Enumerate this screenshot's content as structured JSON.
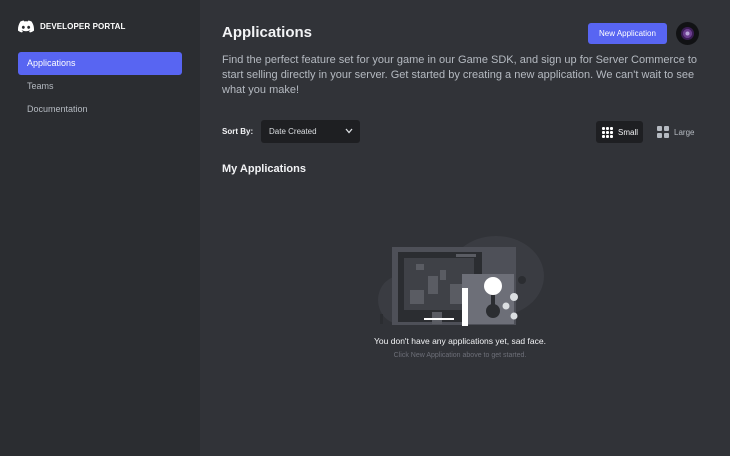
{
  "brand": {
    "name": "DEVELOPER PORTAL",
    "logo": "discord-logo-icon"
  },
  "sidebar": {
    "items": [
      {
        "label": "Applications",
        "active": true
      },
      {
        "label": "Teams",
        "active": false
      },
      {
        "label": "Documentation",
        "active": false
      }
    ]
  },
  "header": {
    "title": "Applications",
    "new_button": "New Application",
    "avatar": "user-avatar"
  },
  "intro_text": "Find the perfect feature set for your game in our Game SDK, and sign up for Server Commerce to start selling directly in your server. Get started by creating a new application. We can't wait to see what you make!",
  "sort": {
    "label": "Sort By:",
    "value": "Date Created"
  },
  "view_toggle": {
    "small_label": "Small",
    "large_label": "Large",
    "selected": "Small"
  },
  "section": {
    "title": "My Applications"
  },
  "empty_state": {
    "title": "You don't have any applications yet, sad face.",
    "subtitle": "Click New Application above to get started.",
    "illustration": "arcade-controller-illustration"
  },
  "colors": {
    "accent": "#5865f2",
    "sidebar_bg": "#2b2d31",
    "main_bg": "#313338",
    "input_bg": "#1e1f22"
  }
}
